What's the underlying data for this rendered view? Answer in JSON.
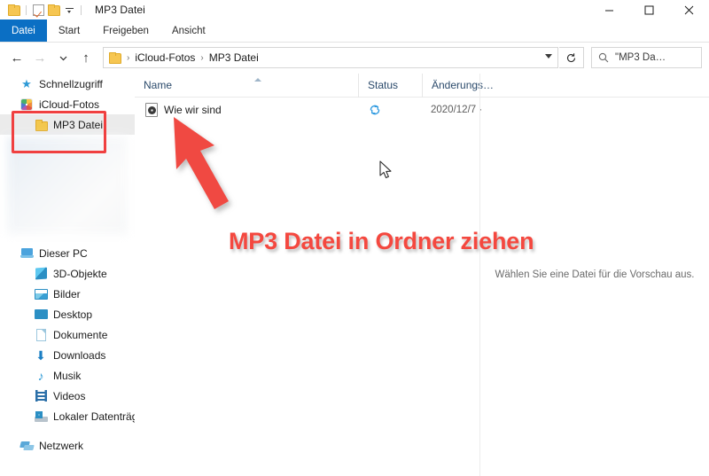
{
  "window": {
    "title": "MP3 Datei",
    "quick_access": [
      {
        "name": "folder-icon"
      },
      {
        "name": "properties-checkbox-icon"
      },
      {
        "name": "new-folder-icon"
      },
      {
        "name": "customize-quick-access-caret"
      }
    ],
    "controls": {
      "minimize": "minimize-button",
      "maximize": "maximize-button",
      "close": "close-button"
    }
  },
  "ribbon": {
    "tabs": [
      {
        "label": "Datei",
        "active": true
      },
      {
        "label": "Start",
        "active": false
      },
      {
        "label": "Freigeben",
        "active": false
      },
      {
        "label": "Ansicht",
        "active": false
      }
    ]
  },
  "address_bar": {
    "back": "←",
    "forward": "→",
    "recent": "⌄",
    "up": "↑",
    "breadcrumbs": [
      "iCloud-Fotos",
      "MP3 Datei"
    ],
    "separator": "›",
    "refresh": "refresh-icon",
    "search_value": "\"MP3 Da…"
  },
  "sidebar": {
    "groups": [
      {
        "items": [
          {
            "label": "Schnellzugriff",
            "icon": "star-icon",
            "level": 0,
            "selected": false
          },
          {
            "label": "iCloud-Fotos",
            "icon": "icloud-photos-icon",
            "level": 0,
            "selected": false
          },
          {
            "label": "MP3 Datei",
            "icon": "folder-icon",
            "level": 1,
            "selected": true
          }
        ]
      },
      {
        "items": [
          {
            "label": "Dieser PC",
            "icon": "this-pc-icon",
            "level": 0,
            "selected": false
          },
          {
            "label": "3D-Objekte",
            "icon": "3d-objects-icon",
            "level": 1,
            "selected": false
          },
          {
            "label": "Bilder",
            "icon": "pictures-icon",
            "level": 1,
            "selected": false
          },
          {
            "label": "Desktop",
            "icon": "desktop-icon",
            "level": 1,
            "selected": false
          },
          {
            "label": "Dokumente",
            "icon": "documents-icon",
            "level": 1,
            "selected": false
          },
          {
            "label": "Downloads",
            "icon": "downloads-icon",
            "level": 1,
            "selected": false
          },
          {
            "label": "Musik",
            "icon": "music-icon",
            "level": 1,
            "selected": false
          },
          {
            "label": "Videos",
            "icon": "videos-icon",
            "level": 1,
            "selected": false
          },
          {
            "label": "Lokaler Datenträger",
            "icon": "local-disk-icon",
            "level": 1,
            "selected": false
          }
        ]
      },
      {
        "items": [
          {
            "label": "Netzwerk",
            "icon": "network-icon",
            "level": 0,
            "selected": false
          }
        ]
      }
    ]
  },
  "file_list": {
    "columns": [
      {
        "label": "Name",
        "sorted": "asc"
      },
      {
        "label": "Status",
        "sorted": ""
      },
      {
        "label": "Änderungs…",
        "sorted": ""
      }
    ],
    "rows": [
      {
        "name": "Wie wir sind",
        "icon": "mp3-file-icon",
        "status_icon": "cloud-sync-icon",
        "date": "2020/12/7 ·"
      }
    ]
  },
  "preview": {
    "empty_text": "Wählen Sie eine Datei für die Vorschau aus."
  },
  "annotations": {
    "callout_text": "MP3 Datei in Ordner ziehen",
    "highlight_rect": "sidebar-folders-highlight",
    "arrow": "drag-target-arrow",
    "cursor": "mouse-cursor"
  },
  "colors": {
    "accent": "#0b6fc4",
    "annotation_red": "#f4483f",
    "highlight_border": "#f04040",
    "sync_blue": "#2f9ae0",
    "selected_row": "#ebebeb"
  }
}
